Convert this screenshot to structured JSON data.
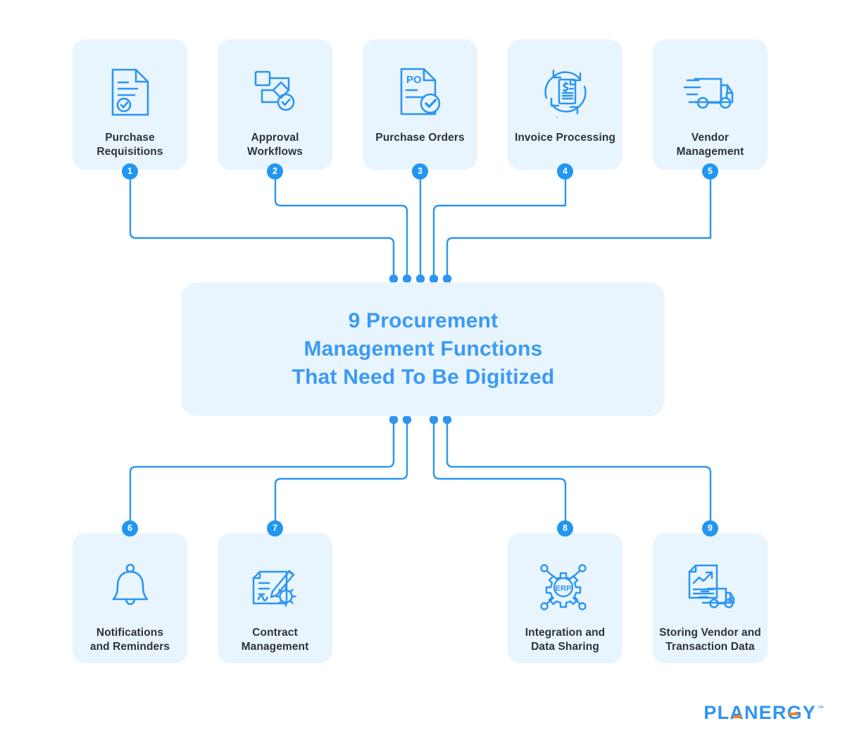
{
  "center": {
    "title_line1": "9 Procurement",
    "title_line2": "Management Functions",
    "title_line3": "That Need To Be Digitized",
    "accent_color": "#3b9af5",
    "background_color": "#e9f5fe"
  },
  "theme": {
    "card_background": "#e9f5fe",
    "icon_stroke": "#2b95f2",
    "badge_background": "#2196f3",
    "badge_text": "#ffffff",
    "label_color": "#2d3338",
    "page_background": "#ffffff"
  },
  "top_nodes": [
    {
      "number": "1",
      "label_line1": "Purchase",
      "label_line2": "Requisitions",
      "icon": "document-check-icon"
    },
    {
      "number": "2",
      "label_line1": "Approval",
      "label_line2": "Workflows",
      "icon": "workflow-diagram-icon"
    },
    {
      "number": "3",
      "label_line1": "Purchase Orders",
      "label_line2": "",
      "icon": "purchase-order-document-icon"
    },
    {
      "number": "4",
      "label_line1": "Invoice Processing",
      "label_line2": "",
      "icon": "invoice-cycle-icon"
    },
    {
      "number": "5",
      "label_line1": "Vendor",
      "label_line2": "Management",
      "icon": "delivery-truck-icon"
    }
  ],
  "bottom_nodes": [
    {
      "number": "6",
      "label_line1": "Notifications",
      "label_line2": "and Reminders",
      "icon": "bell-icon"
    },
    {
      "number": "7",
      "label_line1": "Contract",
      "label_line2": "Management",
      "icon": "contract-pen-gear-icon"
    },
    {
      "number": "8",
      "label_line1": "Integration and",
      "label_line2": "Data Sharing",
      "icon": "erp-gear-network-icon"
    },
    {
      "number": "9",
      "label_line1": "Storing Vendor and",
      "label_line2": "Transaction Data",
      "icon": "report-truck-icon"
    }
  ],
  "logo": {
    "text": "PLANERGY",
    "trademark": "™",
    "primary_color": "#2f93f5",
    "accent_color": "#f5821f"
  }
}
